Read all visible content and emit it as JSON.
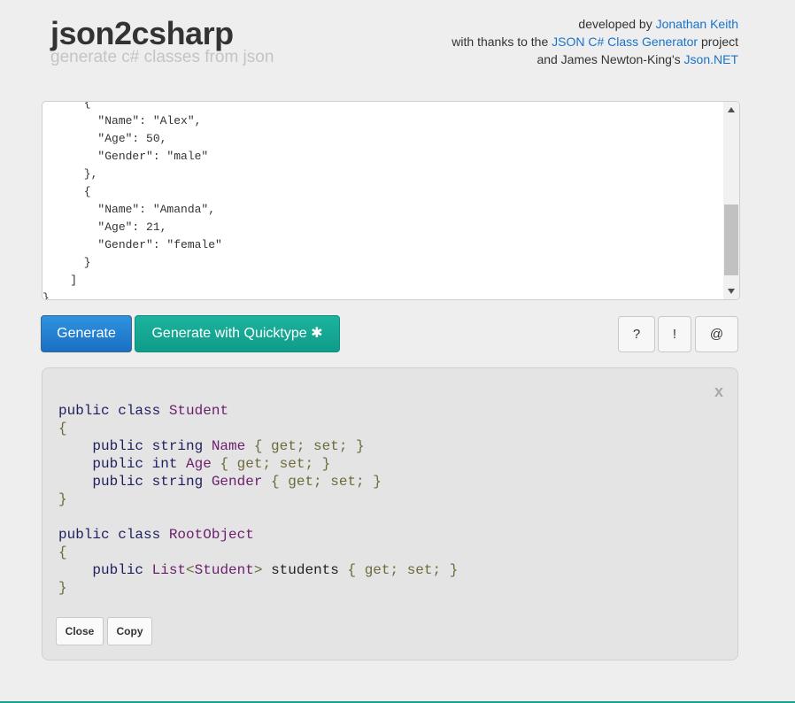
{
  "header": {
    "title": "json2csharp",
    "subtitle": "generate c# classes from json",
    "credits": {
      "line1_prefix": "developed by ",
      "line1_link": "Jonathan Keith",
      "line2_prefix": "with thanks to the ",
      "line2_link": "JSON C# Class Generator",
      "line2_suffix": " project",
      "line3_prefix": "and James Newton-King's ",
      "line3_link": "Json.NET"
    }
  },
  "input_editor": {
    "lines": [
      "      {",
      "        \"Name\": \"Alex\",",
      "        \"Age\": 50,",
      "        \"Gender\": \"male\"",
      "      },",
      "      {",
      "        \"Name\": \"Amanda\",",
      "        \"Age\": 21,",
      "        \"Gender\": \"female\"",
      "      }",
      "    ]",
      "}"
    ]
  },
  "toolbar": {
    "generate_label": "Generate",
    "quicktype_label": "Generate with Quicktype ✱",
    "help_label": "?",
    "info_label": "!",
    "contact_label": "@"
  },
  "output": {
    "close_x": "x",
    "close_label": "Close",
    "copy_label": "Copy",
    "code": {
      "l1_kw": "public class ",
      "l1_ty": "Student",
      "l2": "{",
      "l3_kw": "    public string ",
      "l3_ty": "Name",
      "l3_pu": " { get; set; }",
      "l4_kw": "    public int ",
      "l4_ty": "Age",
      "l4_pu": " { get; set; }",
      "l5_kw": "    public string ",
      "l5_ty": "Gender",
      "l5_pu": " { get; set; }",
      "l6": "}",
      "l8_kw": "public class ",
      "l8_ty": "RootObject",
      "l9": "{",
      "l10_kw": "    public ",
      "l10_ty1": "List",
      "l10_p1": "<",
      "l10_ty2": "Student",
      "l10_p2": ">",
      "l10_id": " students",
      "l10_pu": " { get; set; }",
      "l11": "}"
    }
  },
  "colors": {
    "generate_button": "#1a73c8",
    "quicktype_button": "#14a893",
    "link": "#1a73c8"
  }
}
